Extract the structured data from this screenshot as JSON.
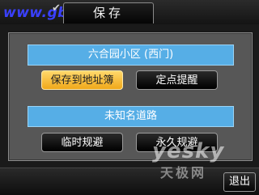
{
  "watermark": {
    "top": "www.gbsuu.com",
    "brand": "yesky",
    "brand_cn": "天极网"
  },
  "header": {
    "check_icon": "check-icon",
    "title": "保存"
  },
  "location": {
    "name": "六合园小区 (西门)",
    "save_to_address_book": "保存到地址簿",
    "fixed_point_reminder": "定点提醒"
  },
  "road": {
    "name": "未知名道路",
    "temporary_avoid": "临时规避",
    "permanent_avoid": "永久规避"
  },
  "footer": {
    "exit": "退出"
  },
  "colors": {
    "highlight_bar": "#56aee6",
    "selected_button": "#f5b52a",
    "panel": "#575757"
  }
}
